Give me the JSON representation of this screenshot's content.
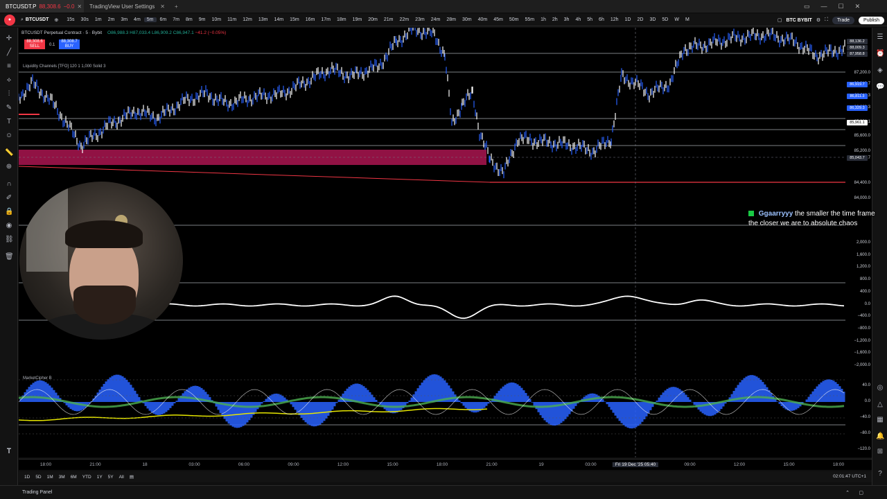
{
  "browser": {
    "tabs": [
      {
        "title": "BTCUSDT.P",
        "price": "88,308.6",
        "change": "−0.0"
      },
      {
        "title": "TradingView User Settings"
      }
    ]
  },
  "toolbar": {
    "symbol": "BTCUSDT",
    "timeframes": [
      "15s",
      "30s",
      "1m",
      "2m",
      "3m",
      "4m",
      "5m",
      "6m",
      "7m",
      "8m",
      "9m",
      "10m",
      "11m",
      "12m",
      "13m",
      "14m",
      "15m",
      "16m",
      "17m",
      "18m",
      "19m",
      "20m",
      "21m",
      "22m",
      "23m",
      "24m",
      "28m",
      "30m",
      "40m",
      "45m",
      "50m",
      "55m",
      "1h",
      "2h",
      "3h",
      "4h",
      "5h",
      "6h",
      "12h",
      "1D",
      "2D",
      "3D",
      "5D",
      "W",
      "M"
    ],
    "active_timeframe": "5m",
    "exchange_badge": "BTC BYBIT",
    "trade_label": "Trade",
    "publish_label": "Publish"
  },
  "legend": {
    "title": "BTCUSDT Perpetual Contract · 5 · Bybit",
    "ohlc": "O86,988.3 H87,033.4 L86,909.2 C86,947.1",
    "change": "−41.2 (−0.05%)",
    "sell_price": "88,308.6",
    "sell_label": "SELL",
    "spread": "0.1",
    "buy_price": "88,308.7",
    "buy_label": "BUY",
    "liquidity_label": "Liquidity Channels [TFO] 120 1 1,000 Solid 3",
    "marketcipher_label": "MarketCipher B"
  },
  "price_scale": [
    "87,200.0",
    "86,919.7",
    "86,811.3",
    "86,329.3",
    "85,961.1",
    "85,600.0",
    "85,200.0",
    "85,043.7",
    "84,400.0",
    "84,000.0"
  ],
  "price_tags": {
    "top1": "88,136.2",
    "top2": "88,009.3",
    "top3": "87,958.8",
    "blue1": "86,919.7",
    "blue2": "86,811.3",
    "blue3": "86,329.3",
    "mid": "85,961.1",
    "cross": "85,043.7"
  },
  "osc_scale": [
    "2,000.0",
    "1,600.0",
    "1,200.0",
    "800.0",
    "400.0",
    "0.0",
    "−400.0",
    "−800.0",
    "−1,200.0",
    "−1,600.0",
    "−2,000.0"
  ],
  "mc_scale": [
    "40.0",
    "0.0",
    "−40.0",
    "−80.0",
    "−120.0"
  ],
  "time_axis": [
    "18:00",
    "21:00",
    "18",
    "03:00",
    "06:00",
    "09:00",
    "12:00",
    "15:00",
    "18:00",
    "21:00",
    "19",
    "03:00",
    "06:00",
    "09:00",
    "12:00",
    "15:00",
    "18:00"
  ],
  "crosshair_time": "Fri 19 Dec '25 05:40",
  "ranges": [
    "1D",
    "5D",
    "1M",
    "3M",
    "6M",
    "YTD",
    "1Y",
    "5Y",
    "All"
  ],
  "clock": "02:01:47 UTC+1",
  "bottom_panel": "Trading Panel",
  "chat": {
    "user": "Ggaarryyy",
    "message": "the smaller the time frame the closer we are to absolute chaos"
  },
  "colors": {
    "bull": "#ffffff",
    "bear": "#2962ff",
    "accent_red": "#f23645",
    "mc_blue": "#2962ff",
    "mc_green": "#4caf50",
    "mc_yellow": "#e6e600"
  },
  "icons": [
    "plus-icon",
    "crosshair-icon",
    "trendline-icon",
    "fib-icon",
    "brush-icon",
    "text-icon",
    "measure-icon",
    "zoom-icon",
    "magnet-icon",
    "lock-icon",
    "trash-icon",
    "watchlist-icon",
    "alerts-icon",
    "chat-icon"
  ]
}
